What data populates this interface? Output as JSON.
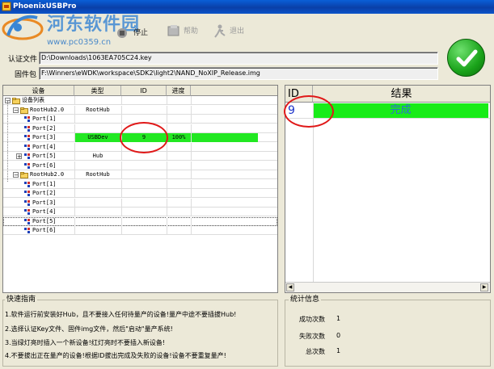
{
  "window": {
    "title": "PhoenixUSBPro"
  },
  "watermark": {
    "title": "河东软件园",
    "url": "www.pc0359.cn"
  },
  "toolbar": {
    "items": [
      {
        "label": "停止",
        "icon": "stop-icon"
      },
      {
        "label": "帮助",
        "icon": "help-icon"
      },
      {
        "label": "退出",
        "icon": "exit-icon"
      }
    ]
  },
  "fields": {
    "key_label": "认证文件",
    "key_value": "D:\\Downloads\\1063EA705C24.key",
    "firmware_label": "固件包",
    "firmware_value": "F:\\Winners\\eWDK\\workspace\\SDK2\\light2\\NAND_NoXIP_Release.img"
  },
  "device_table": {
    "columns": [
      "设备",
      "类型",
      "ID",
      "进度"
    ],
    "rows": [
      {
        "label": "设备列表",
        "level": 0,
        "kind": "root",
        "type": "",
        "id": "",
        "progress": ""
      },
      {
        "label": "RootHub2.0",
        "level": 1,
        "kind": "hub",
        "type": "RootHub",
        "id": "",
        "progress": ""
      },
      {
        "label": "Port[1]",
        "level": 2,
        "kind": "port",
        "type": "",
        "id": "",
        "progress": ""
      },
      {
        "label": "Port[2]",
        "level": 2,
        "kind": "port",
        "type": "",
        "id": "",
        "progress": ""
      },
      {
        "label": "Port[3]",
        "level": 2,
        "kind": "port",
        "type": "USBDev",
        "id": "9",
        "progress": "100%",
        "active": true
      },
      {
        "label": "Port[4]",
        "level": 2,
        "kind": "port",
        "type": "",
        "id": "",
        "progress": ""
      },
      {
        "label": "Port[5]",
        "level": 2,
        "kind": "port-exp",
        "type": "Hub",
        "id": "",
        "progress": ""
      },
      {
        "label": "Port[6]",
        "level": 2,
        "kind": "port",
        "type": "",
        "id": "",
        "progress": ""
      },
      {
        "label": "RootHub2.0",
        "level": 1,
        "kind": "hub",
        "type": "RootHub",
        "id": "",
        "progress": ""
      },
      {
        "label": "Port[1]",
        "level": 2,
        "kind": "port",
        "type": "",
        "id": "",
        "progress": ""
      },
      {
        "label": "Port[2]",
        "level": 2,
        "kind": "port",
        "type": "",
        "id": "",
        "progress": ""
      },
      {
        "label": "Port[3]",
        "level": 2,
        "kind": "port",
        "type": "",
        "id": "",
        "progress": ""
      },
      {
        "label": "Port[4]",
        "level": 2,
        "kind": "port",
        "type": "",
        "id": "",
        "progress": ""
      },
      {
        "label": "Port[5]",
        "level": 2,
        "kind": "port",
        "type": "",
        "id": "",
        "progress": "",
        "selected": true
      },
      {
        "label": "Port[6]",
        "level": 2,
        "kind": "port",
        "type": "",
        "id": "",
        "progress": ""
      }
    ]
  },
  "result_table": {
    "columns": [
      "ID",
      "结果"
    ],
    "rows": [
      {
        "id": "9",
        "result": "完成"
      }
    ]
  },
  "guide": {
    "title": "快速指南",
    "lines": [
      "1.软件运行前安装好Hub，且不要接入任何待量产的设备!量产中途不要插拔Hub!",
      "2.选择认证Key文件、固件img文件，然后\"启动\"量产系统!",
      "3.当绿灯亮时插入一个新设备!红灯亮时不要插入新设备!",
      "4.不要拔出正在量产的设备!根据ID拔出完成及失败的设备!设备不要重复量产!"
    ]
  },
  "stats": {
    "title": "统计信息",
    "items": [
      {
        "label": "成功次数",
        "value": "1"
      },
      {
        "label": "失败次数",
        "value": "0"
      },
      {
        "label": "总次数",
        "value": "1"
      }
    ]
  },
  "colors": {
    "active_row": "#22e822",
    "result_row": "#18ec18",
    "annotation": "#e01818",
    "id_text": "#1a32c8"
  }
}
